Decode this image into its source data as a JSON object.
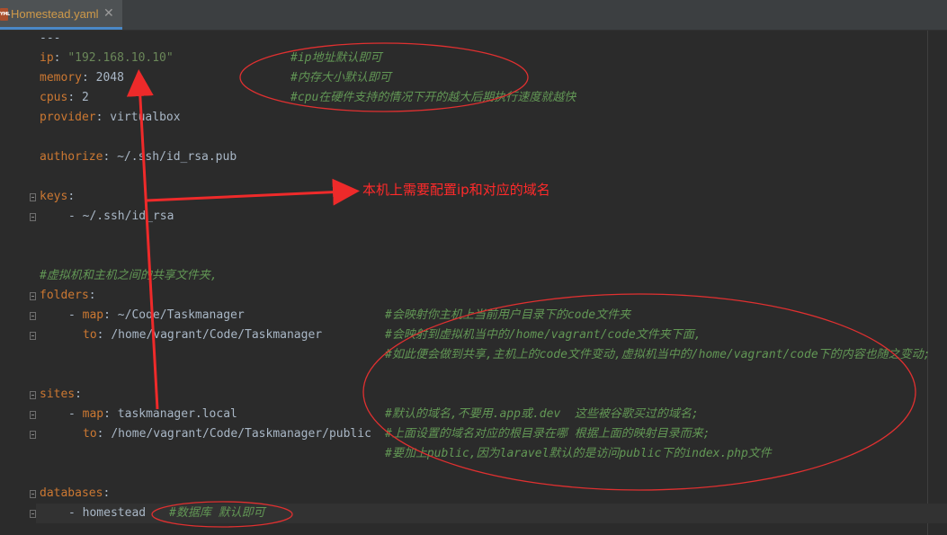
{
  "tab": {
    "title": "Homestead.yaml",
    "icon_text": "YML",
    "close_glyph": "✕"
  },
  "code": {
    "doc_start": "---",
    "ip_key": "ip",
    "ip_value": "\"192.168.10.10\"",
    "ip_comment": "#ip地址默认即可",
    "memory_key": "memory",
    "memory_value": "2048",
    "memory_comment": "#内存大小默认即可",
    "cpus_key": "cpus",
    "cpus_value": "2",
    "cpus_comment": "#cpu在硬件支持的情况下开的越大后期执行速度就越快",
    "provider_key": "provider",
    "provider_value": "virtualbox",
    "authorize_key": "authorize",
    "authorize_value": "~/.ssh/id_rsa.pub",
    "keys_key": "keys",
    "keys_item": "~/.ssh/id_rsa",
    "folders_comment": "#虚拟机和主机之间的共享文件夹,",
    "folders_key": "folders",
    "map_key": "map",
    "folders_map_value": "~/Code/Taskmanager",
    "folders_map_comment": "#会映射你主机上当前用户目录下的code文件夹",
    "to_key": "to",
    "folders_to_value": "/home/vagrant/Code/Taskmanager",
    "folders_to_comment": "#会映射到虚拟机当中的/home/vagrant/code文件夹下面,",
    "folders_extra_comment": "#如此便会做到共享,主机上的code文件变动,虚拟机当中的/home/vagrant/code下的内容也随之变动;",
    "sites_key": "sites",
    "sites_map_value": "taskmanager.local",
    "sites_map_comment": "#默认的域名,不要用.app或.dev  这些被谷歌买过的域名;",
    "sites_to_value": "/home/vagrant/Code/Taskmanager/public",
    "sites_to_comment": "#上面设置的域名对应的根目录在哪 根据上面的映射目录而来;",
    "sites_extra_comment": "#要加上public,因为laravel默认的是访问public下的index.php文件",
    "databases_key": "databases",
    "databases_item": "homestead",
    "databases_comment": "#数据库 默认即可"
  },
  "annotation": {
    "text": "本机上需要配置ip和对应的域名",
    "color": "#ff2a2a"
  },
  "colors": {
    "key": "#cc7832",
    "string": "#6a8759",
    "comment": "#629755",
    "text": "#a9b7c6",
    "background": "#2b2b2b"
  }
}
